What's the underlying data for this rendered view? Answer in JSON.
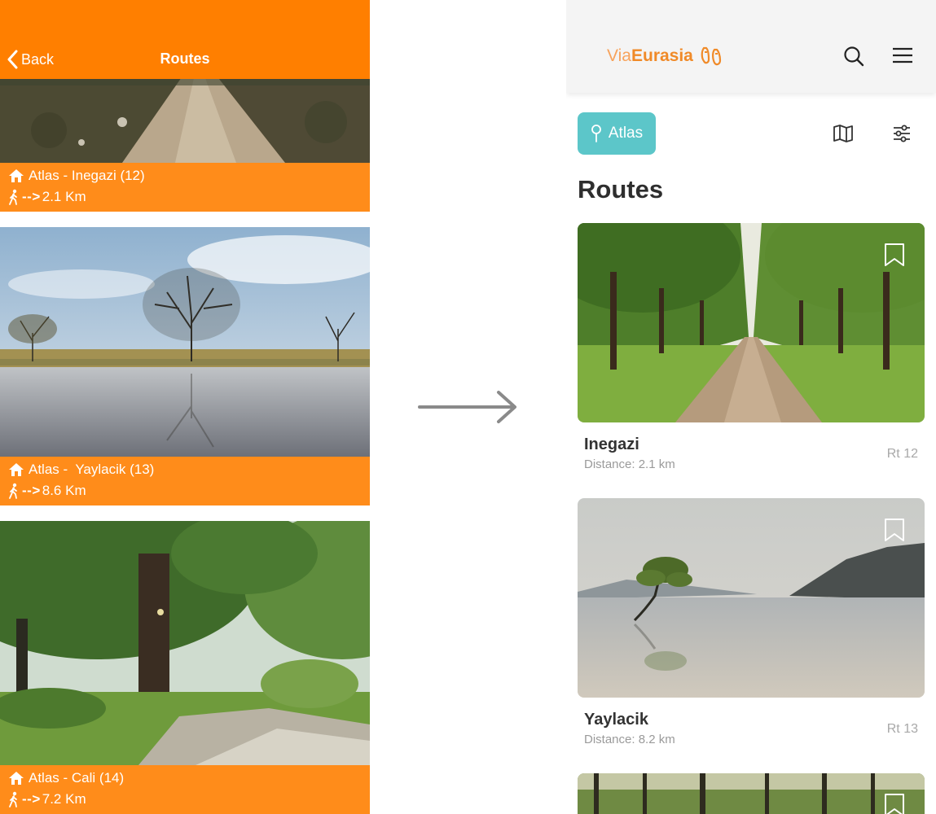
{
  "old_app": {
    "header": {
      "back_label": "Back",
      "title": "Routes"
    },
    "routes": [
      {
        "title": "Atlas - Inegazi (12)",
        "arrow": "-->",
        "distance": "2.1 Km"
      },
      {
        "title": "Atlas -  Yaylacik (13)",
        "arrow": "-->",
        "distance": "8.6 Km"
      },
      {
        "title": "Atlas - Cali (14)",
        "arrow": "-->",
        "distance": "7.2 Km"
      }
    ]
  },
  "new_app": {
    "logo": {
      "part1": "Via",
      "part2": "Eurasia"
    },
    "location_chip": "Atlas",
    "section_title": "Routes",
    "routes": [
      {
        "name": "Inegazi",
        "distance": "Distance: 2.1 km",
        "rt": "Rt 12"
      },
      {
        "name": "Yaylacik",
        "distance": "Distance: 8.2 km",
        "rt": "Rt 13"
      }
    ]
  },
  "colors": {
    "old_header": "#ff7f00",
    "old_info_bar": "#ff8c1a",
    "new_accent": "#5cc6c9",
    "logo_orange": "#f08a28"
  },
  "icons": {
    "old_back": "chevron-left-icon",
    "old_route_title": "home-icon",
    "old_route_distance": "walking-person-icon",
    "transition": "right-arrow-icon",
    "new_search": "search-icon",
    "new_menu": "hamburger-menu-icon",
    "new_location": "location-pin-icon",
    "new_map": "map-icon",
    "new_filter": "filter-sliders-icon",
    "new_bookmark": "bookmark-icon",
    "logo": "footprints-icon"
  }
}
